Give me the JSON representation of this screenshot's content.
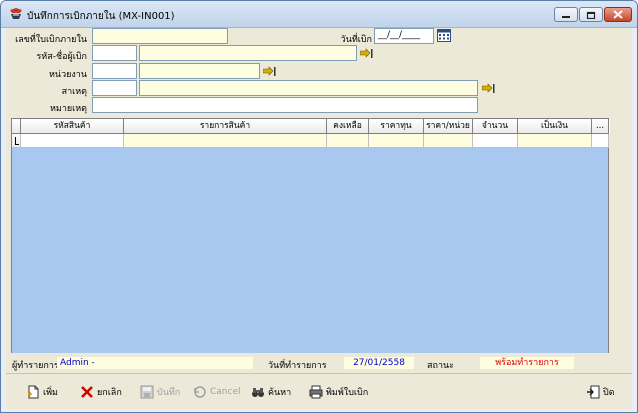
{
  "window": {
    "title": "บันทึกการเบิกภายใน (MX-IN001)"
  },
  "form": {
    "doc_no_label": "เลขที่ใบเบิกภายใน",
    "doc_no_value": "",
    "date_label": "วันที่เบิก",
    "date_value": "__/__/____",
    "requester_label": "รหัส-ชื่อผู้เบิก",
    "unit_label": "หน่วยงาน",
    "reason_label": "สาเหตุ",
    "note_label": "หมายเหตุ"
  },
  "grid": {
    "columns": [
      "รหัสสินค้า",
      "รายการสินค้า",
      "คงเหลือ",
      "ราคาทุน",
      "ราคา/หน่วย",
      "จำนวน",
      "เป็นเงิน",
      "..."
    ]
  },
  "status": {
    "operator_label": "ผู้ทำรายการ",
    "operator_value": "Admin -",
    "date_label": "วันที่ทำรายการ",
    "date_value": "27/01/2558",
    "state_label": "สถานะ",
    "state_value": "พร้อมทำรายการ",
    "state_color": "#e00000",
    "value_color": "#0000cc"
  },
  "toolbar": {
    "add": "เพิ่ม",
    "cancel_doc": "ยกเลิก",
    "save": "บันทึก",
    "cancel": "Cancel",
    "search": "ค้นหา",
    "print": "พิมพ์ใบเบิก",
    "close": "ปิด"
  }
}
